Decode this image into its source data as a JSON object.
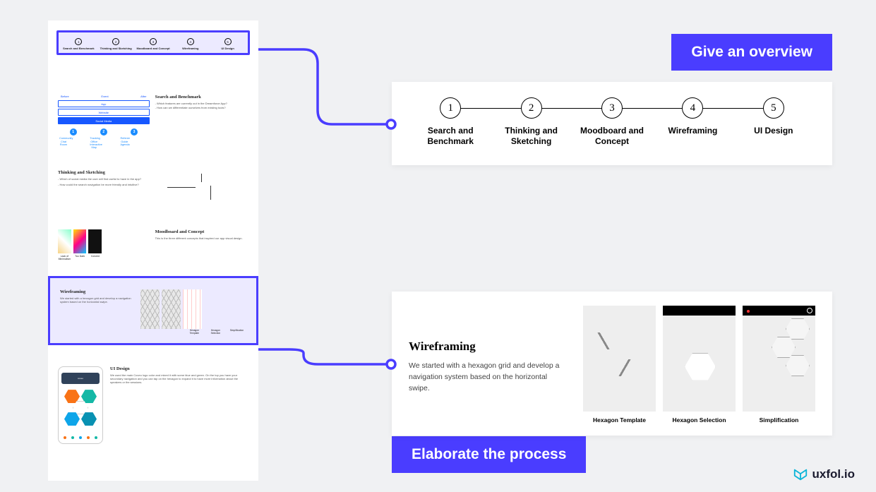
{
  "callouts": {
    "overview": "Give an overview",
    "elaborate": "Elaborate the process"
  },
  "steps": [
    {
      "num": "1",
      "label": "Search and Benchmark"
    },
    {
      "num": "2",
      "label": "Thinking and Sketching"
    },
    {
      "num": "3",
      "label": "Moodboard and Concept"
    },
    {
      "num": "4",
      "label": "Wireframing"
    },
    {
      "num": "5",
      "label": "UI Design"
    }
  ],
  "wireframing": {
    "title": "Wireframing",
    "body": "We started with a hexagon grid and develop a navigation system based on the horizontal swipe.",
    "captions": [
      "Hexagon Template",
      "Hexagon Selection",
      "Simplification"
    ]
  },
  "portfolio": {
    "sb": {
      "tabs": [
        "Before",
        "Event",
        "After"
      ],
      "buttons": {
        "app": "App",
        "web": "Website",
        "sm": "Social Media"
      },
      "icons": [
        {
          "n": "1",
          "a": "Community",
          "b": "Chat Room"
        },
        {
          "n": "2",
          "a": "Tracking Office",
          "b": "Interactive Map"
        },
        {
          "n": "3",
          "a": "Referee Guide",
          "b": "Agenda"
        }
      ],
      "title": "Search and Benchmark",
      "q1": "- Which features are currently out in the Dreamforce App?",
      "q2": "- How can we differentiate ourselves from existing tools?"
    },
    "ts": {
      "title": "Thinking and Sketching",
      "q1": "- Which of social media the user will find useful to have in the app?",
      "q2": "- How could the search navigation be more friendly and intuitive?"
    },
    "mb": {
      "title": "Moodboard and Concept",
      "body": "This is the three different concepts that inspired our app visual design.",
      "caps": [
        "Lack of Minimalism",
        "Too Dark",
        "Colored"
      ]
    },
    "wf": {
      "title": "Wireframing",
      "body": "We started with a hexagon grid and develop a navigation system based on the horizontal swipe.",
      "caps": [
        "Hexagon Template",
        "Hexagon Selection",
        "Simplification"
      ]
    },
    "ui": {
      "brand": "coveo",
      "title": "UI Design",
      "body": "We used the main Coveo logo color and mixed it with some blue and green. On the top you have your secondary navigation and you can tap on the hexagon to expand it to have more information about the speakers or the sessions."
    }
  },
  "logo": "uxfol.io"
}
